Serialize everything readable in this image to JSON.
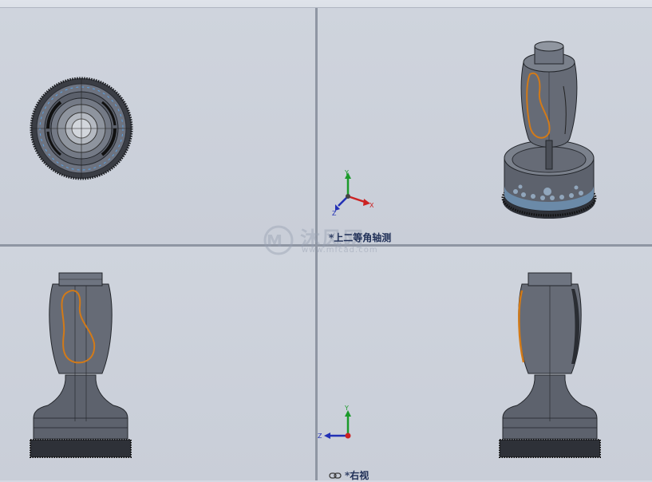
{
  "toolbar": {
    "buttons": [
      {
        "name": "zoom-to-fit-icon",
        "has_caret": false
      },
      {
        "name": "zoom-area-icon",
        "has_caret": false
      },
      {
        "name": "previous-view-icon",
        "has_caret": false
      },
      {
        "name": "section-view-icon",
        "has_caret": true
      },
      {
        "name": "view-orientation-icon",
        "has_caret": true
      },
      {
        "name": "display-style-icon",
        "has_caret": true
      },
      {
        "name": "hide-show-items-icon",
        "has_caret": true
      },
      {
        "name": "edit-appearance-icon",
        "has_caret": false
      },
      {
        "name": "apply-scene-icon",
        "has_caret": true
      },
      {
        "name": "view-settings-icon",
        "has_caret": true
      }
    ]
  },
  "views": {
    "top_right_label": "*上二等角轴测",
    "bottom_right_label": "*右视",
    "bottom_right_label_icon": "link-view-icon"
  },
  "triad": {
    "iso": {
      "y": "Y",
      "x": "X",
      "z": "Z"
    },
    "right": {
      "y": "Y",
      "z": "Z"
    }
  },
  "watermark": {
    "text": "沐风网",
    "url": "www.mfcad.com"
  },
  "colors": {
    "viewport_bg": "#c9ced8",
    "splitter": "#8f96a3",
    "model_body": "#5a5f6b",
    "grip_outline": "#d27a18",
    "triad_x": "#cc2222",
    "triad_y": "#1b9a2a",
    "triad_z": "#2230b5",
    "label_text": "#1e2e56"
  }
}
